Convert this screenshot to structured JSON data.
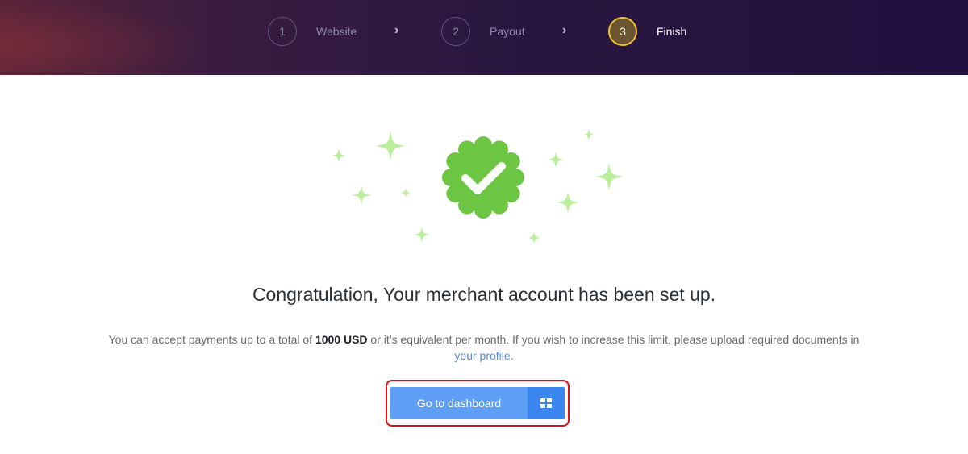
{
  "steps": [
    {
      "number": "1",
      "label": "Website",
      "state": "inactive"
    },
    {
      "number": "2",
      "label": "Payout",
      "state": "inactive"
    },
    {
      "number": "3",
      "label": "Finish",
      "state": "active"
    }
  ],
  "step_separator_icon": "chevron-right-icon",
  "colors": {
    "accent_active_step": "#f0c338",
    "badge_green": "#6cc644",
    "sparkle_green": "#b9ef9a",
    "button_blue": "#5e9ff5",
    "button_icon_blue": "#3b86ef",
    "highlight_red": "#e0101b",
    "link": "#5c8ddf"
  },
  "success": {
    "badge_icon": "verified-check-badge-icon",
    "sparkles_icon": "sparkle-star-icon",
    "headline": "Congratulation, Your merchant account has been set up.",
    "message_before": "You can accept payments up to a total of ",
    "limit": "1000 USD",
    "message_after": " or it’s equivalent per month. If you wish to increase this limit, please upload required documents in ",
    "profile_link": "your profile",
    "message_end": "."
  },
  "dashboard_button": {
    "label": "Go to dashboard",
    "icon": "dashboard-grid-icon"
  }
}
